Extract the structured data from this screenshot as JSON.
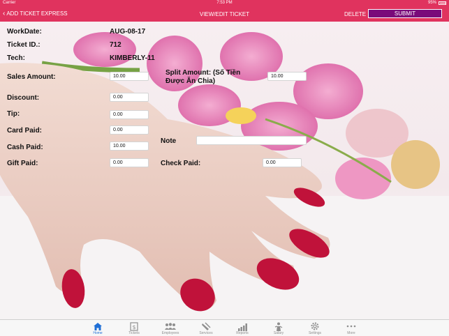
{
  "status_bar": {
    "carrier": "Carrier",
    "time": "7:53 PM",
    "battery": "95%"
  },
  "nav": {
    "back_label": "ADD TICKET EXPRESS",
    "title": "VIEW/EDIT TICKET",
    "delete_label": "DELETE",
    "submit_label": "SUBMIT"
  },
  "form": {
    "workdate": {
      "label": "WorkDate:",
      "value": "AUG-08-17"
    },
    "ticket_id": {
      "label": "Ticket ID.:",
      "value": "712"
    },
    "tech": {
      "label": "Tech:",
      "value": "KIMBERLY-11"
    },
    "sales_amount": {
      "label": "Sales Amount:",
      "value": "10.00"
    },
    "split_amount": {
      "label": "Split Amount: (Số Tiền\nĐược Ăn Chia)",
      "value": "10.00"
    },
    "discount": {
      "label": "Discount:",
      "value": "0.00"
    },
    "tip": {
      "label": "Tip:",
      "value": "0.00"
    },
    "card_paid": {
      "label": "Card Paid:",
      "value": "0.00"
    },
    "cash_paid": {
      "label": "Cash Paid:",
      "value": "10.00"
    },
    "note": {
      "label": "Note",
      "value": ""
    },
    "gift_paid": {
      "label": "Gift Paid:",
      "value": "0.00"
    },
    "check_paid": {
      "label": "Check Paid:",
      "value": "0.00"
    }
  },
  "tabs": [
    {
      "label": "Home",
      "icon": "home-icon",
      "active": true
    },
    {
      "label": "Tickets",
      "icon": "ticket-icon",
      "active": false
    },
    {
      "label": "Employees",
      "icon": "employees-icon",
      "active": false
    },
    {
      "label": "Services",
      "icon": "services-icon",
      "active": false
    },
    {
      "label": "Reports",
      "icon": "reports-icon",
      "active": false
    },
    {
      "label": "Salary",
      "icon": "salary-icon",
      "active": false
    },
    {
      "label": "Settings",
      "icon": "gear-icon",
      "active": false
    },
    {
      "label": "More",
      "icon": "more-icon",
      "active": false
    }
  ],
  "colors": {
    "accent": "#e0335e",
    "submit_bg": "#7a0a7a",
    "tab_active": "#1f6fd6",
    "tab_inactive": "#8e8e8e"
  }
}
